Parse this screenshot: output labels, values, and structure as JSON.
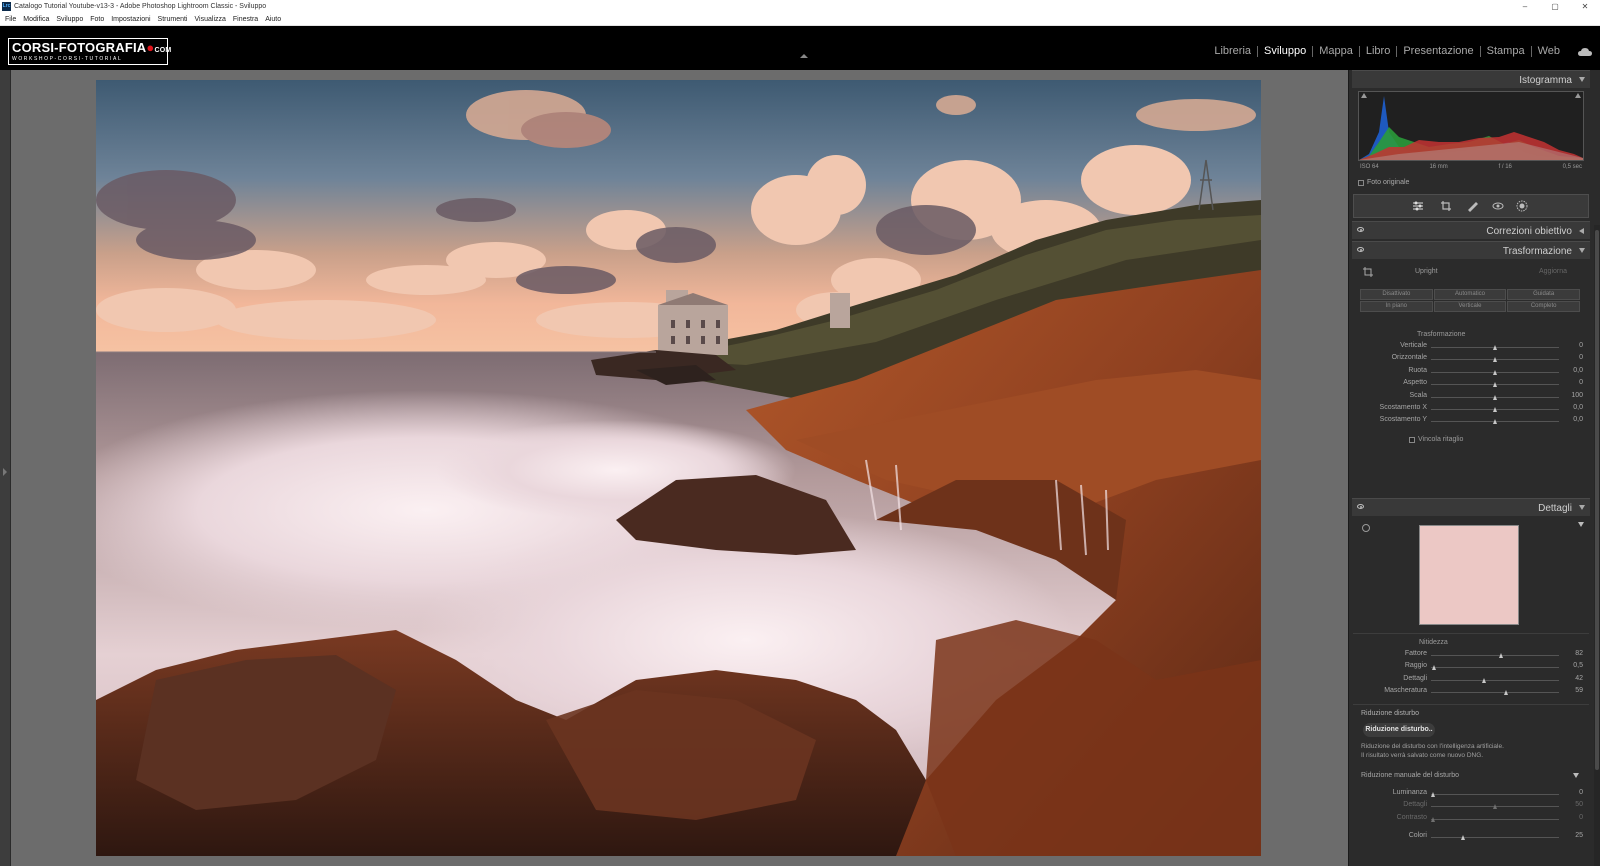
{
  "window": {
    "title": "Catalogo Tutorial Youtube-v13-3 - Adobe Photoshop Lightroom Classic - Sviluppo",
    "app_icon": "Lrc",
    "controls": [
      "–",
      "▢",
      "✕"
    ]
  },
  "menu": [
    "File",
    "Modifica",
    "Sviluppo",
    "Foto",
    "Impostazioni",
    "Strumenti",
    "Visualizza",
    "Finestra",
    "Aiuto"
  ],
  "identity_plate": {
    "main": "CORSI-FOTOGRAFIA",
    "dot": "●",
    "com": "COM",
    "sub": "WORKSHOP-CORSI-TUTORIAL",
    "accent": "#e0141b"
  },
  "modules": [
    {
      "label": "Libreria",
      "active": false
    },
    {
      "label": "Sviluppo",
      "active": true
    },
    {
      "label": "Mappa",
      "active": false
    },
    {
      "label": "Libro",
      "active": false
    },
    {
      "label": "Presentazione",
      "active": false
    },
    {
      "label": "Stampa",
      "active": false
    },
    {
      "label": "Web",
      "active": false
    }
  ],
  "histogram": {
    "title": "Istogramma",
    "iso": "ISO 64",
    "focal": "16 mm",
    "aperture": "f / 16",
    "shutter": "0,5 sec",
    "original_photo": "Foto originale"
  },
  "tools": [
    "sliders-icon",
    "crop-icon",
    "healing-brush-icon",
    "red-eye-icon",
    "masking-icon"
  ],
  "panels": {
    "lens": {
      "title": "Correzioni obiettivo"
    },
    "transform": {
      "title": "Trasformazione",
      "upright_label": "Upright",
      "update_label": "Aggiorna",
      "buttons": [
        "Disattivato",
        "Automatico",
        "Guidata",
        "In piano",
        "Verticale",
        "Completo"
      ],
      "section_label": "Trasformazione",
      "sliders": [
        {
          "label": "Verticale",
          "value": "0",
          "pos": 0.5
        },
        {
          "label": "Orizzontale",
          "value": "0",
          "pos": 0.5
        },
        {
          "label": "Ruota",
          "value": "0,0",
          "pos": 0.5
        },
        {
          "label": "Aspetto",
          "value": "0",
          "pos": 0.5
        },
        {
          "label": "Scala",
          "value": "100",
          "pos": 0.5
        },
        {
          "label": "Scostamento X",
          "value": "0,0",
          "pos": 0.5
        },
        {
          "label": "Scostamento Y",
          "value": "0,0",
          "pos": 0.5
        }
      ],
      "constrain_crop": "Vincola ritaglio"
    },
    "details": {
      "title": "Dettagli",
      "sharpening_label": "Nitidezza",
      "sliders": [
        {
          "label": "Fattore",
          "value": "82",
          "pos": 0.55
        },
        {
          "label": "Raggio",
          "value": "0,5",
          "pos": 0.03
        },
        {
          "label": "Dettagli",
          "value": "42",
          "pos": 0.42
        },
        {
          "label": "Mascheratura",
          "value": "59",
          "pos": 0.59
        }
      ],
      "noise_label": "Riduzione disturbo",
      "noise_button": "Riduzione disturbo..",
      "noise_desc_1": "Riduzione del disturbo con l'intelligenza artificiale.",
      "noise_desc_2": "Il risultato verrà salvato come nuovo DNG.",
      "manual_label": "Riduzione manuale del disturbo",
      "manual_sliders": [
        {
          "label": "Luminanza",
          "value": "0",
          "pos": 0.02,
          "dim": false
        },
        {
          "label": "Dettagli",
          "value": "50",
          "pos": 0.5,
          "dim": true
        },
        {
          "label": "Contrasto",
          "value": "0",
          "pos": 0.02,
          "dim": true
        },
        {
          "label": "Colori",
          "value": "25",
          "pos": 0.25,
          "dim": false
        }
      ]
    }
  }
}
